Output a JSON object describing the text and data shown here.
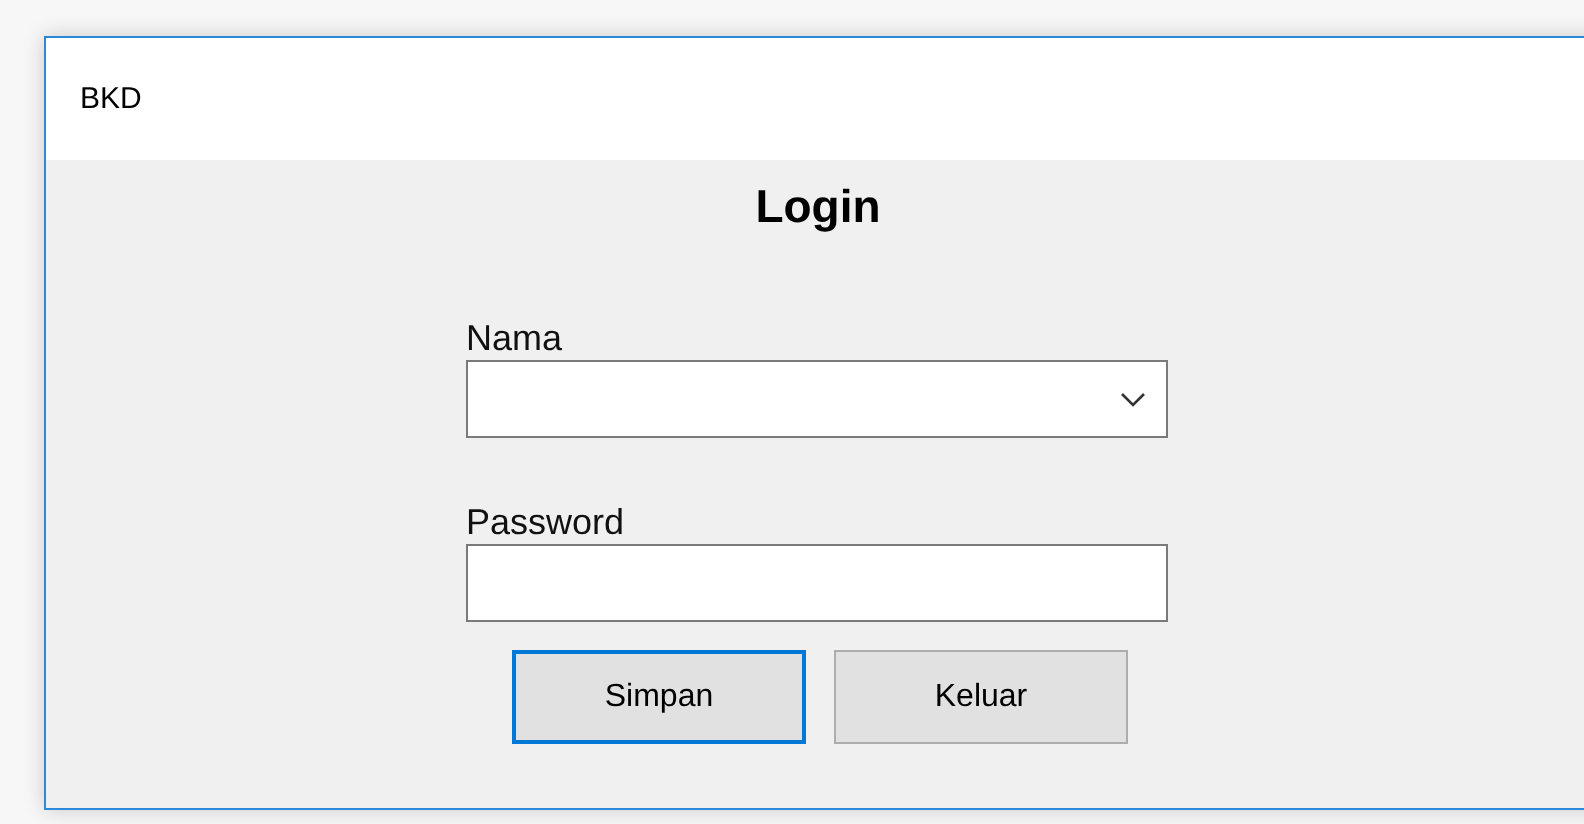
{
  "window": {
    "title": "BKD"
  },
  "heading": "Login",
  "fields": [
    {
      "label": "Nama",
      "kind": "dropdown"
    },
    {
      "label": "Password",
      "kind": "password"
    }
  ],
  "buttons": [
    {
      "label": "Simpan",
      "focused": true
    },
    {
      "label": "Keluar",
      "focused": false
    }
  ]
}
